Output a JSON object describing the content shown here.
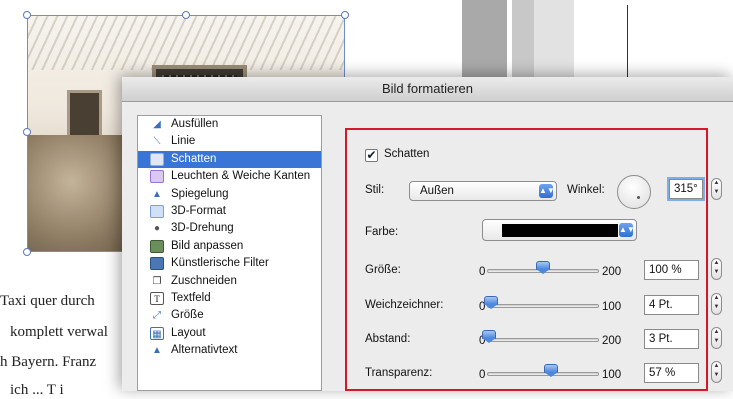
{
  "document": {
    "text_lines": [
      "Taxi quer durch",
      "komplett verwal",
      "h Bayern. Franz",
      "ich ... T i"
    ]
  },
  "dialog": {
    "title": "Bild formatieren",
    "categories": [
      {
        "label": "Ausfüllen",
        "icon": "paint-bucket-icon"
      },
      {
        "label": "Linie",
        "icon": "line-icon"
      },
      {
        "label": "Schatten",
        "icon": "shadow-icon",
        "selected": true
      },
      {
        "label": "Leuchten & Weiche Kanten",
        "icon": "glow-icon"
      },
      {
        "label": "Spiegelung",
        "icon": "reflection-icon"
      },
      {
        "label": "3D-Format",
        "icon": "3d-format-icon"
      },
      {
        "label": "3D-Drehung",
        "icon": "3d-rotation-icon"
      },
      {
        "label": "Bild anpassen",
        "icon": "adjust-picture-icon"
      },
      {
        "label": "Künstlerische Filter",
        "icon": "artistic-filter-icon"
      },
      {
        "label": "Zuschneiden",
        "icon": "crop-icon"
      },
      {
        "label": "Textfeld",
        "icon": "textbox-icon"
      },
      {
        "label": "Größe",
        "icon": "size-icon"
      },
      {
        "label": "Layout",
        "icon": "layout-icon"
      },
      {
        "label": "Alternativtext",
        "icon": "alt-text-icon"
      }
    ],
    "shadow": {
      "enabled_label": "Schatten",
      "enabled": true,
      "style_label": "Stil:",
      "style_value": "Außen",
      "angle_label": "Winkel:",
      "angle_value": "315°",
      "color_label": "Farbe:",
      "color_value": "#000000",
      "size": {
        "label": "Größe:",
        "min": "0",
        "max": "200",
        "value": "100 %",
        "level": 100,
        "range": 200
      },
      "blur": {
        "label": "Weichzeichner:",
        "min": "0",
        "max": "100",
        "value": "4 Pt.",
        "level": 4,
        "range": 100
      },
      "distance": {
        "label": "Abstand:",
        "min": "0",
        "max": "200",
        "value": "3 Pt.",
        "level": 3,
        "range": 200
      },
      "transparency": {
        "label": "Transparenz:",
        "min": "0",
        "max": "100",
        "value": "57 %",
        "level": 57,
        "range": 100
      }
    }
  },
  "colors": {
    "accent": "#3875d7",
    "highlight_border": "#d3182a"
  }
}
